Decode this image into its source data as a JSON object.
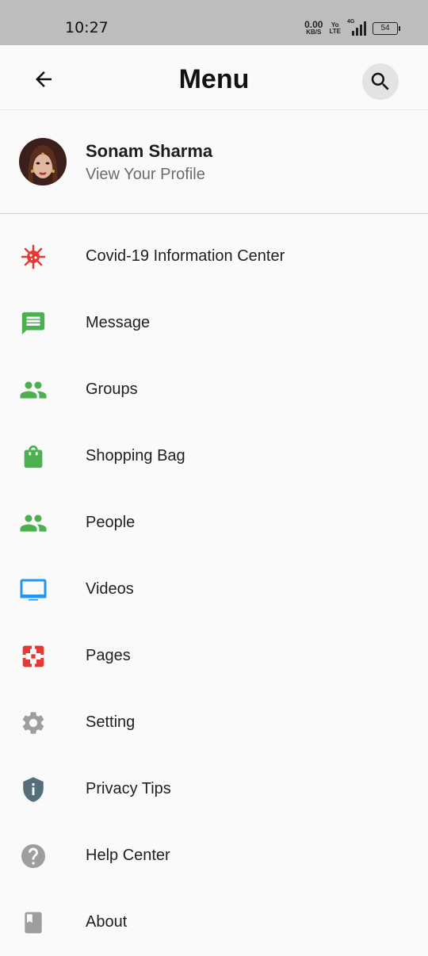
{
  "status_bar": {
    "time": "10:27",
    "net_speed_value": "0.00",
    "net_speed_unit": "KB/S",
    "volte_top": "Yo",
    "volte_bottom": "LTE",
    "network_type": "4G",
    "battery": "54"
  },
  "header": {
    "title": "Menu",
    "back_icon": "arrow-back-icon",
    "search_icon": "search-icon"
  },
  "profile": {
    "name": "Sonam Sharma",
    "subtitle": "View Your Profile"
  },
  "menu": {
    "items": [
      {
        "label": "Covid-19 Information Center",
        "icon": "virus-icon",
        "color": "#e53935"
      },
      {
        "label": "Message",
        "icon": "message-icon",
        "color": "#4caf50"
      },
      {
        "label": "Groups",
        "icon": "groups-icon",
        "color": "#4caf50"
      },
      {
        "label": "Shopping Bag",
        "icon": "shopping-bag-icon",
        "color": "#4caf50"
      },
      {
        "label": "People",
        "icon": "people-icon",
        "color": "#4caf50"
      },
      {
        "label": "Videos",
        "icon": "tv-icon",
        "color": "#2196f3"
      },
      {
        "label": "Pages",
        "icon": "flag-pages-icon",
        "color": "#e53935"
      },
      {
        "label": "Setting",
        "icon": "gear-icon",
        "color": "#9e9e9e"
      },
      {
        "label": "Privacy Tips",
        "icon": "shield-info-icon",
        "color": "#546e7a"
      },
      {
        "label": "Help Center",
        "icon": "help-icon",
        "color": "#9e9e9e"
      },
      {
        "label": "About",
        "icon": "book-icon",
        "color": "#9e9e9e"
      }
    ]
  }
}
